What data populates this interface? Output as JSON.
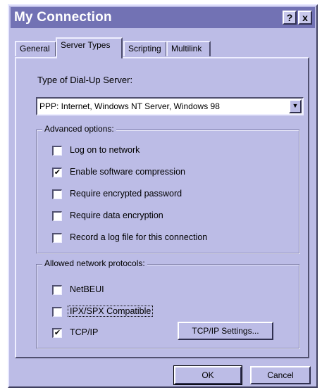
{
  "window": {
    "title": "My Connection",
    "help_button": "?",
    "close_button": "x"
  },
  "tabs": [
    {
      "label": "General"
    },
    {
      "label": "Server Types",
      "active": true
    },
    {
      "label": "Scripting"
    },
    {
      "label": "Multilink"
    }
  ],
  "server_type": {
    "label": "Type of Dial-Up Server:",
    "selected": "PPP: Internet, Windows NT Server, Windows 98"
  },
  "advanced_options": {
    "title": "Advanced options:",
    "items": [
      {
        "label": "Log on to network",
        "checked": false
      },
      {
        "label": "Enable software compression",
        "checked": true
      },
      {
        "label": "Require encrypted password",
        "checked": false
      },
      {
        "label": "Require data encryption",
        "checked": false
      },
      {
        "label": "Record a log file for this connection",
        "checked": false
      }
    ]
  },
  "protocols": {
    "title": "Allowed network protocols:",
    "items": [
      {
        "label": "NetBEUI",
        "checked": false
      },
      {
        "label": "IPX/SPX Compatible",
        "checked": false
      },
      {
        "label": "TCP/IP",
        "checked": true
      }
    ],
    "settings_button": "TCP/IP Settings..."
  },
  "footer": {
    "ok": "OK",
    "cancel": "Cancel"
  },
  "checkmark": "✔",
  "colors": {
    "titlebar": "#7272b4",
    "dialog_face": "#bcbce6"
  }
}
